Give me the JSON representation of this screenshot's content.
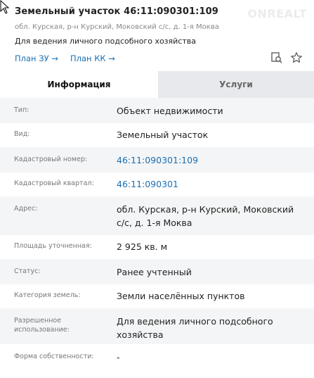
{
  "header": {
    "title": "Земельный участок 46:11:090301:109",
    "watermark": "ONREALT",
    "address": "обл. Курская, р-н Курский, Моковский с/с, д. 1-я Моква",
    "purpose": "Для ведения личного подсобного хозяйства",
    "plan_zu": "План ЗУ →",
    "plan_kk": "План КК →"
  },
  "icons": {
    "search": "search-document-icon",
    "favorite": "star-icon"
  },
  "tabs": {
    "info": "Информация",
    "services": "Услуги"
  },
  "rows": [
    {
      "label": "Тип:",
      "value": "Объект недвижимости",
      "link": false
    },
    {
      "label": "Вид:",
      "value": "Земельный участок",
      "link": false
    },
    {
      "label": "Кадастровый номер:",
      "value": "46:11:090301:109",
      "link": true
    },
    {
      "label": "Кадастровый квартал:",
      "value": "46:11:090301",
      "link": true
    },
    {
      "label": "Адрес:",
      "value": "обл. Курская, р-н Курский, Моковский с/с, д. 1-я Моква",
      "link": false
    },
    {
      "label": "Площадь уточненная:",
      "value": "2 925 кв. м",
      "link": false
    },
    {
      "label": "Статус:",
      "value": "Ранее учтенный",
      "link": false
    },
    {
      "label": "Категория земель:",
      "value": "Земли населённых пунктов",
      "link": false
    },
    {
      "label": "Разрешенное использование:",
      "value": "Для ведения личного подсобного хозяйства",
      "link": false
    },
    {
      "label": "Форма собственности:",
      "value": "-",
      "link": false
    }
  ],
  "colors": {
    "link": "#1a6fb3",
    "row_alt": "#f4f5f6",
    "tab_inactive": "#e7e9ec"
  }
}
